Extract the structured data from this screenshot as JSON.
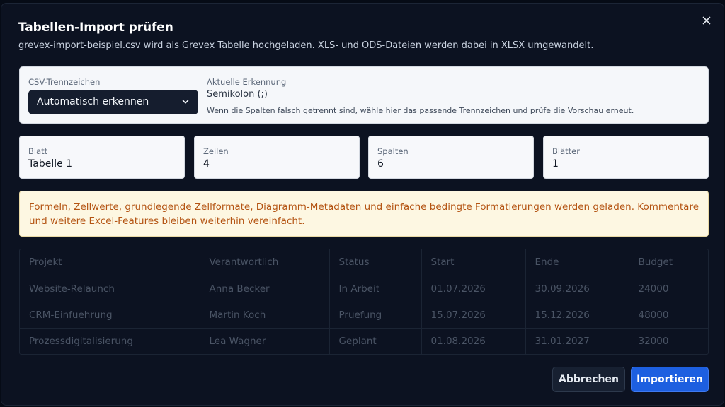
{
  "dialog": {
    "title": "Tabellen-Import prüfen",
    "subtitle": "grevex-import-beispiel.csv wird als Grevex Tabelle hochgeladen. XLS- und ODS-Dateien werden dabei in XLSX umgewandelt.",
    "close_icon": "close-icon"
  },
  "separator": {
    "label": "CSV-Trennzeichen",
    "selected": "Automatisch erkennen",
    "detection_label": "Aktuelle Erkennung",
    "detection_value": "Semikolon (;)",
    "hint": "Wenn die Spalten falsch getrennt sind, wähle hier das passende Trennzeichen und prüfe die Vorschau erneut."
  },
  "stats": [
    {
      "label": "Blatt",
      "value": "Tabelle 1"
    },
    {
      "label": "Zeilen",
      "value": "4"
    },
    {
      "label": "Spalten",
      "value": "6"
    },
    {
      "label": "Blätter",
      "value": "1"
    }
  ],
  "warning": "Formeln, Zellwerte, grundlegende Zellformate, Diagramm-Metadaten und einfache bedingte Formatierungen werden geladen. Kommentare und weitere Excel-Features bleiben weiterhin vereinfacht.",
  "preview": {
    "rows": [
      [
        "Projekt",
        "Verantwortlich",
        "Status",
        "Start",
        "Ende",
        "Budget"
      ],
      [
        "Website-Relaunch",
        "Anna Becker",
        "In Arbeit",
        "01.07.2026",
        "30.09.2026",
        "24000"
      ],
      [
        "CRM-Einfuehrung",
        "Martin Koch",
        "Pruefung",
        "15.07.2026",
        "15.12.2026",
        "48000"
      ],
      [
        "Prozessdigitalisierung",
        "Lea Wagner",
        "Geplant",
        "01.08.2026",
        "31.01.2027",
        "32000"
      ]
    ]
  },
  "buttons": {
    "cancel": "Abbrechen",
    "import": "Importieren"
  },
  "colors": {
    "modal_bg": "#0c1221",
    "accent": "#1d5fe0",
    "warning_text": "#b45413",
    "warning_bg": "#fdf7e2"
  }
}
